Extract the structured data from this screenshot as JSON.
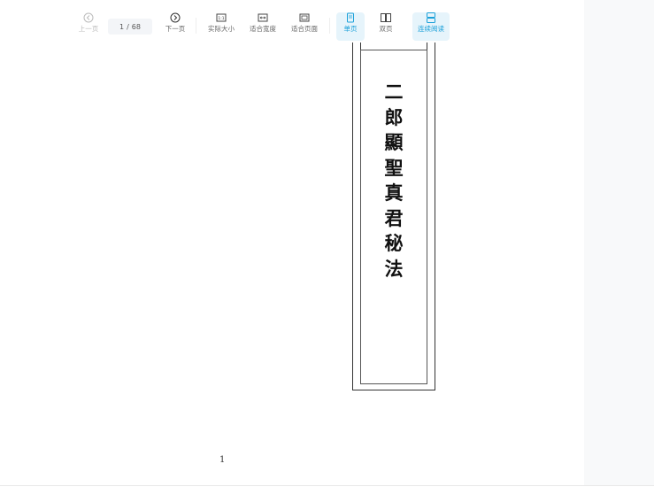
{
  "toolbar": {
    "prev_label": "上一页",
    "current_page": "1",
    "page_separator": "/",
    "total_pages": "68",
    "next_label": "下一页",
    "actual_size_label": "实际大小",
    "fit_width_label": "适合宽度",
    "fit_page_label": "适合页面",
    "single_label": "单页",
    "double_label": "双页",
    "continuous_label": "连续阅读"
  },
  "document": {
    "title_chars": [
      "二",
      "郎",
      "顯",
      "聖",
      "真",
      "君",
      "秘",
      "法"
    ],
    "page_number": "1"
  },
  "colors": {
    "accent": "#1aa0d9",
    "active_bg": "#e6f4fb",
    "side_panel": "#f8f9fa"
  }
}
